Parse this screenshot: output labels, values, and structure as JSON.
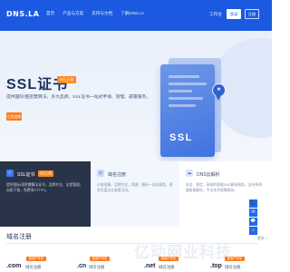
{
  "header": {
    "logo": "DNS.LA",
    "nav": [
      "首页",
      "产品与方案",
      "支持与文档",
      "了解DNS.LA"
    ],
    "workbench": "工作台",
    "login": "登录",
    "register": "注册"
  },
  "hero": {
    "title": "SSL证书",
    "badge": "0元上线",
    "description": "提供国际/国密雙算法，多大品牌，SSL证书一站式申请、管理、部署服务。",
    "button": "立即选购",
    "cert_text": "SSL"
  },
  "cards": [
    {
      "title": "SSL证书",
      "badge": "0元上线",
      "text": "提供国际/国密雙算法证书，品牌齐全，全程管理，自助下载，免费享HTTPS。"
    },
    {
      "title": "域名注册",
      "badge": "",
      "text": "价格低廉，品牌齐全，简便、解析一站式服务，更多优惠点击查看活动。"
    },
    {
      "title": "DNS云解析",
      "badge": "",
      "text": "安全、稳定、高效的智能DNS解析服务，支持多线路智能解析，专业技术保障服务。"
    }
  ],
  "side_tools": [
    "📞",
    "✉",
    "💬",
    "⌂"
  ],
  "domain_section": {
    "title": "域名注册",
    "more": "更多 >",
    "watermark": "亿动网业科技",
    "items": [
      {
        "ext": ".com",
        "label": "域名注册",
        "tag": "新用户专享"
      },
      {
        "ext": ".cn",
        "label": "域名注册",
        "tag": "新用户专享"
      },
      {
        "ext": ".net",
        "label": "域名注册",
        "tag": "新用户专享"
      },
      {
        "ext": ".top",
        "label": "域名注册",
        "tag": "新用户专享"
      }
    ]
  },
  "colors": {
    "header_blue": "#1b5ae0",
    "accent_orange": "#ff7a1a",
    "dark_card": "#2a3448"
  }
}
